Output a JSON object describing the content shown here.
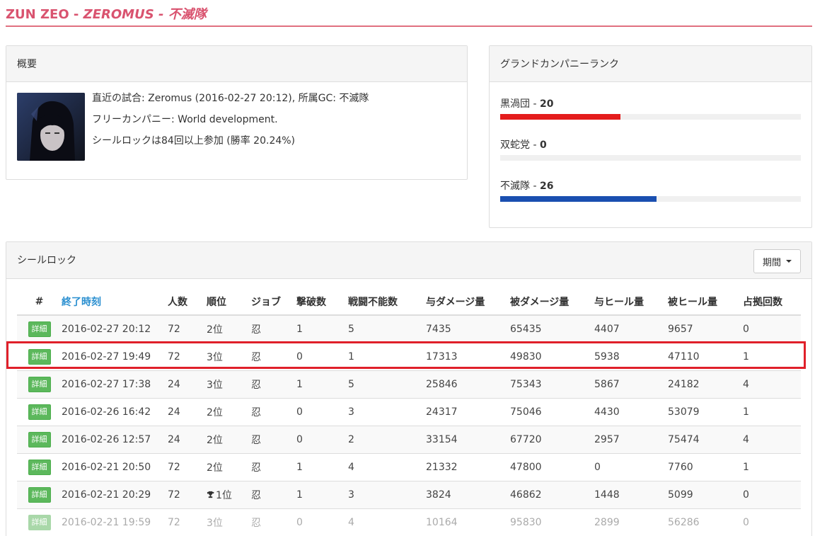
{
  "header": {
    "name": "ZUN ZEO",
    "separator1": " - ",
    "world": "ZEROMUS",
    "separator2": " - ",
    "gc": "不滅隊"
  },
  "overview": {
    "title": "概要",
    "last_match": "直近の試合: Zeromus (2016-02-27 20:12), 所属GC: 不滅隊",
    "free_company": "フリーカンパニー: World development.",
    "participation": "シールロックは84回以上参加 (勝率 20.24%)"
  },
  "gc_rank": {
    "title": "グランドカンパニーランク",
    "items": [
      {
        "label": "黒渦団 - ",
        "value": "20",
        "fraction": 0.4,
        "color": "#e41c1c"
      },
      {
        "label": "双蛇党 - ",
        "value": "0",
        "fraction": 0.0,
        "color": "#e0b000"
      },
      {
        "label": "不滅隊 - ",
        "value": "26",
        "fraction": 0.52,
        "color": "#1a4fb0"
      }
    ]
  },
  "sealrock": {
    "title": "シールロック",
    "period_label": "期間",
    "columns": [
      "#",
      "終了時刻",
      "人数",
      "順位",
      "ジョブ",
      "撃破数",
      "戦闘不能数",
      "与ダメージ量",
      "被ダメージ量",
      "与ヒール量",
      "被ヒール量",
      "占拠回数"
    ],
    "detail_label": "詳細",
    "rows": [
      {
        "time": "2016-02-27 20:12",
        "players": "72",
        "rank": "2位",
        "job": "忍",
        "kills": "1",
        "deaths": "5",
        "dmg_dealt": "7435",
        "dmg_taken": "65435",
        "heal_dealt": "4407",
        "heal_taken": "9657",
        "captures": "0"
      },
      {
        "time": "2016-02-27 19:49",
        "players": "72",
        "rank": "3位",
        "job": "忍",
        "kills": "0",
        "deaths": "1",
        "dmg_dealt": "17313",
        "dmg_taken": "49830",
        "heal_dealt": "5938",
        "heal_taken": "47110",
        "captures": "1"
      },
      {
        "time": "2016-02-27 17:38",
        "players": "24",
        "rank": "3位",
        "job": "忍",
        "kills": "1",
        "deaths": "5",
        "dmg_dealt": "25846",
        "dmg_taken": "75343",
        "heal_dealt": "5867",
        "heal_taken": "24182",
        "captures": "4"
      },
      {
        "time": "2016-02-26 16:42",
        "players": "24",
        "rank": "2位",
        "job": "忍",
        "kills": "0",
        "deaths": "3",
        "dmg_dealt": "24317",
        "dmg_taken": "75046",
        "heal_dealt": "4430",
        "heal_taken": "53079",
        "captures": "1"
      },
      {
        "time": "2016-02-26 12:57",
        "players": "24",
        "rank": "2位",
        "job": "忍",
        "kills": "0",
        "deaths": "2",
        "dmg_dealt": "33154",
        "dmg_taken": "67720",
        "heal_dealt": "2957",
        "heal_taken": "75474",
        "captures": "4"
      },
      {
        "time": "2016-02-21 20:50",
        "players": "72",
        "rank": "2位",
        "job": "忍",
        "kills": "1",
        "deaths": "4",
        "dmg_dealt": "21332",
        "dmg_taken": "47800",
        "heal_dealt": "0",
        "heal_taken": "7760",
        "captures": "1"
      },
      {
        "time": "2016-02-21 20:29",
        "players": "72",
        "rank": "1位",
        "trophy": true,
        "job": "忍",
        "kills": "1",
        "deaths": "3",
        "dmg_dealt": "3824",
        "dmg_taken": "46862",
        "heal_dealt": "1448",
        "heal_taken": "5099",
        "captures": "0"
      },
      {
        "time": "2016-02-21 19:59",
        "players": "72",
        "rank": "3位",
        "job": "忍",
        "kills": "0",
        "deaths": "4",
        "dmg_dealt": "10164",
        "dmg_taken": "95830",
        "heal_dealt": "2899",
        "heal_taken": "56286",
        "captures": "0",
        "faded": true
      }
    ]
  }
}
